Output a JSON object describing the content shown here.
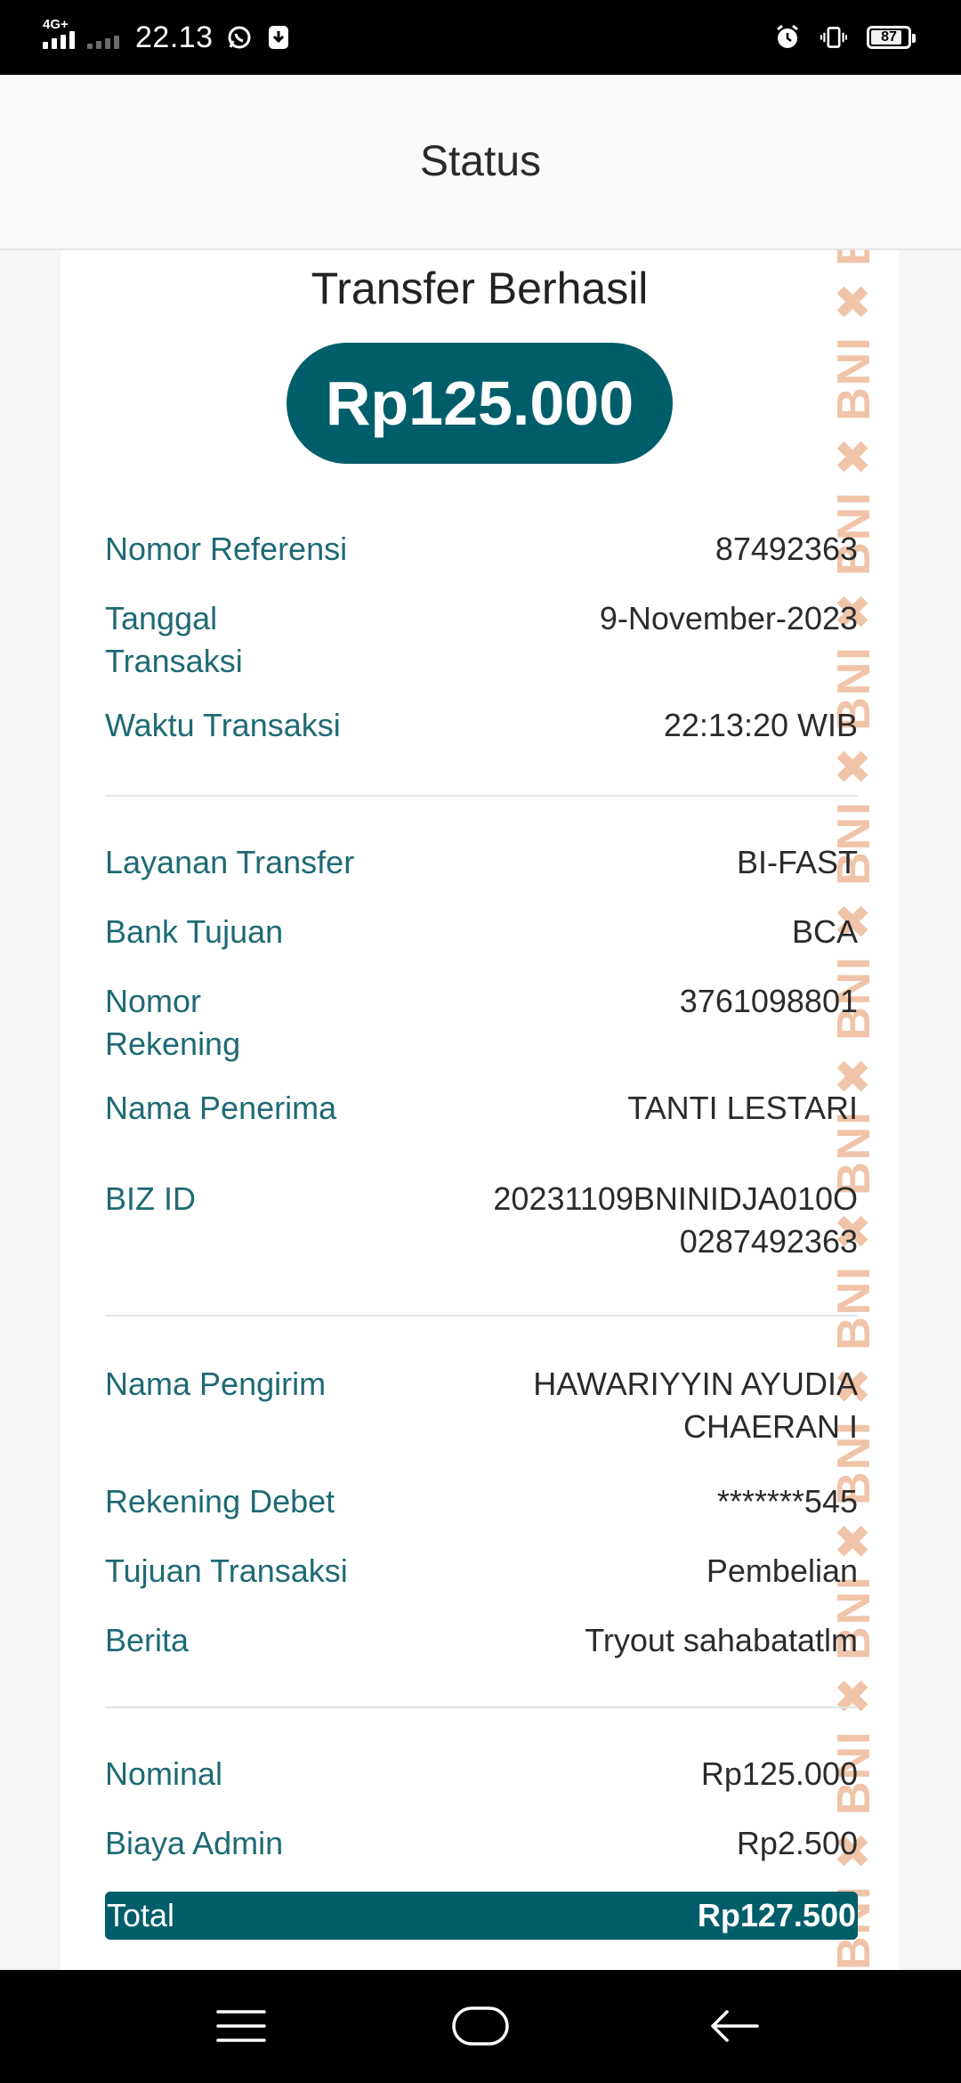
{
  "status_bar": {
    "network": "4G+",
    "time": "22.13",
    "battery": "87",
    "battery_level": 0.87
  },
  "header": {
    "title": "Status"
  },
  "receipt": {
    "title": "Transfer Berhasil",
    "amount": "Rp125.000",
    "watermark_text": "BNI",
    "rows": {
      "ref_label": "Nomor Referensi",
      "ref_value": "87492363",
      "date_label_1": "Tanggal",
      "date_label_2": "Transaksi",
      "date_value": "9-November-2023",
      "time_label": "Waktu Transaksi",
      "time_value": "22:13:20 WIB",
      "service_label": "Layanan Transfer",
      "service_value": "BI-FAST",
      "bank_label": "Bank Tujuan",
      "bank_value": "BCA",
      "account_label_1": "Nomor",
      "account_label_2": "Rekening",
      "account_value": "3761098801",
      "recipient_label": "Nama Penerima",
      "recipient_value": "TANTI LESTARI",
      "bizid_label": "BIZ ID",
      "bizid_value_1": "20231109BNINIDJA010O",
      "bizid_value_2": "0287492363",
      "sender_label": "Nama Pengirim",
      "sender_value_1": "HAWARIYYIN AYUDIA",
      "sender_value_2": "CHAERAN I",
      "debit_label": "Rekening Debet",
      "debit_value": "*******545",
      "purpose_label": "Tujuan Transaksi",
      "purpose_value": "Pembelian",
      "note_label": "Berita",
      "note_value": "Tryout sahabatatlm",
      "nominal_label": "Nominal",
      "nominal_value": "Rp125.000",
      "fee_label": "Biaya Admin",
      "fee_value": "Rp2.500",
      "total_label": "Total",
      "total_value": "Rp127.500"
    }
  },
  "nav_bar": {
    "icons": [
      "menu-icon",
      "home-icon",
      "back-icon"
    ]
  },
  "colors": {
    "accent": "#005e6a",
    "label": "#1e6a74",
    "watermark": "#f0c4a8"
  }
}
